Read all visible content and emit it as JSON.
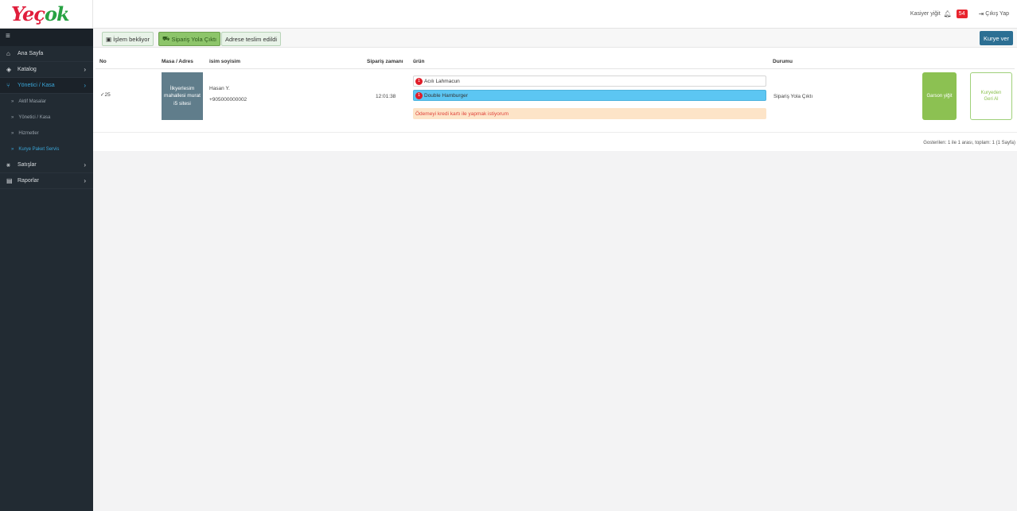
{
  "brand": {
    "logo_part1": "Ye",
    "logo_part2": "ç",
    "logo_part3": "ok"
  },
  "header": {
    "user": "Kasiyer yiğit",
    "notification_count": "54",
    "logout": "Çıkış Yap"
  },
  "sidebar": {
    "items": [
      {
        "label": "Ana Sayfa",
        "icon": "home-icon"
      },
      {
        "label": "Katalog",
        "icon": "tag-icon"
      },
      {
        "label": "Yönetici / Kasa",
        "icon": "utensils-icon"
      },
      {
        "label": "Satışlar",
        "icon": "cart-icon"
      },
      {
        "label": "Raporlar",
        "icon": "file-icon"
      }
    ],
    "subitems": [
      {
        "label": "Aktif Masalar"
      },
      {
        "label": "Yönetici / Kasa"
      },
      {
        "label": "Hizmetler"
      },
      {
        "label": "Kurye Paket Servis"
      }
    ]
  },
  "toolbar": {
    "tab1": "İşlem bekliyor",
    "tab2": "Sipariş Yola Çıktı",
    "tab3": "Adrese teslim edildi",
    "kurye_button": "Kurye ver"
  },
  "table": {
    "headers": {
      "no": "No",
      "address": "Masa / Adres",
      "name": "isim soyisim",
      "time": "Sipariş zamanı",
      "product": "ürün",
      "status": "Durumu"
    },
    "row": {
      "no": "25",
      "address": "İlkyerlesim mahallesi murat i5 sitesi",
      "customer_name": "Hasan Y.",
      "phone": "+905000000002",
      "time": "12:01:38",
      "products": [
        {
          "qty": "1",
          "name": "Acılı Lahmacun"
        },
        {
          "qty": "1",
          "name": "Double Hamburger"
        }
      ],
      "note": "Ödemeyi kredi kartı ile yapmak istiyorum",
      "status": "Sipariş Yola Çıktı",
      "courier_button": "Garson yiğit",
      "return_button_line1": "Kuryeden",
      "return_button_line2": "Geri Al"
    }
  },
  "pagination": {
    "text": "Gosterilen: 1 ile 1 arası, toplam: 1 (1 Sayfa)"
  },
  "colors": {
    "accent": "#3aa6d8",
    "green": "#8cc152",
    "sidebar": "#222b33",
    "badge": "#e8242e"
  }
}
